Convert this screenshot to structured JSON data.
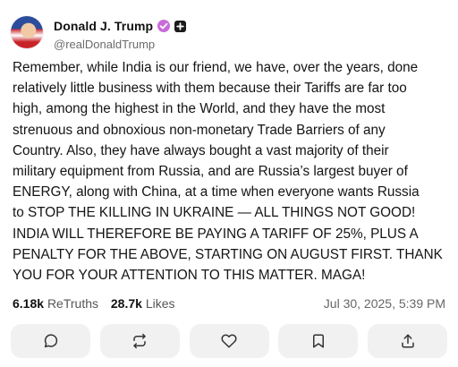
{
  "post": {
    "author": {
      "display_name": "Donald J. Trump",
      "handle": "@realDonaldTrump",
      "verified_color": "#c76cd9"
    },
    "text": "Remember, while India is our friend, we have, over the years, done\nrelatively little business with them because their Tariffs are far too\nhigh, among the highest in the World, and they have the most\nstrenuous and obnoxious non-monetary Trade Barriers of any\nCountry. Also, they have always bought a vast majority of their\nmilitary equipment from Russia, and are Russia’s largest buyer of\nENERGY, along with China, at a time when everyone wants Russia\nto STOP THE KILLING IN UKRAINE — ALL THINGS NOT GOOD!\nINDIA WILL THEREFORE BE PAYING A TARIFF OF 25%, PLUS A\nPENALTY FOR THE ABOVE, STARTING ON AUGUST FIRST. THANK\nYOU FOR YOUR ATTENTION TO THIS MATTER. MAGA!",
    "stats": {
      "retruths_count": "6.18k",
      "retruths_label": "ReTruths",
      "likes_count": "28.7k",
      "likes_label": "Likes"
    },
    "timestamp": "Jul 30, 2025, 5:39 PM"
  },
  "actions": {
    "icons": [
      "comment-icon",
      "retruth-icon",
      "like-icon",
      "bookmark-icon",
      "share-icon"
    ]
  }
}
